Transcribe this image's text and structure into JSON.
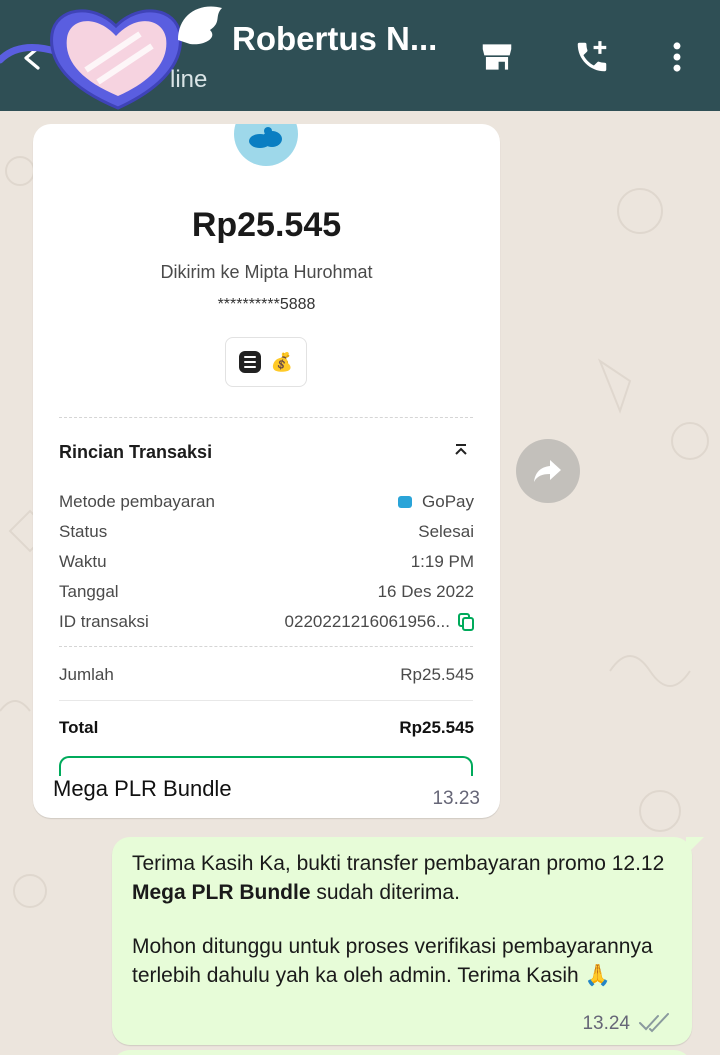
{
  "header": {
    "contact_name": "Robertus N...",
    "status": "line",
    "icons": [
      "back-arrow-icon",
      "heart-sticker",
      "store-icon",
      "add-call-icon",
      "more-vert-icon"
    ],
    "bg_color": "#2f4f55"
  },
  "receipt": {
    "amount": "Rp25.545",
    "sent_to": "Dikirim ke Mipta Hurohmat",
    "account": "**********5888",
    "section_title": "Rincian Transaksi",
    "rows": [
      {
        "label": "Metode pembayaran",
        "value": "GoPay"
      },
      {
        "label": "Status",
        "value": "Selesai"
      },
      {
        "label": "Waktu",
        "value": "1:19 PM"
      },
      {
        "label": "Tanggal",
        "value": "16 Des 2022"
      },
      {
        "label": "ID transaksi",
        "value": "0220221216061956..."
      }
    ],
    "jumlah_label": "Jumlah",
    "jumlah_value": "Rp25.545",
    "total_label": "Total",
    "total_value": "Rp25.545"
  },
  "incoming": {
    "caption": "Mega PLR Bundle",
    "time": "13.23"
  },
  "outgoing": {
    "p1_a": "Terima Kasih Ka, bukti transfer pembayaran promo 12.12 ",
    "p1_bold": "Mega PLR Bundle",
    "p1_b": " sudah diterima.",
    "p2": "Mohon ditunggu untuk proses verifikasi pembayarannya terlebih dahulu yah ka oleh admin. Terima Kasih 🙏",
    "time": "13.24"
  },
  "colors": {
    "chat_bg": "#ece5dd",
    "outgoing_bubble": "#e7fcd8",
    "gopay_green": "#00aa5b"
  }
}
